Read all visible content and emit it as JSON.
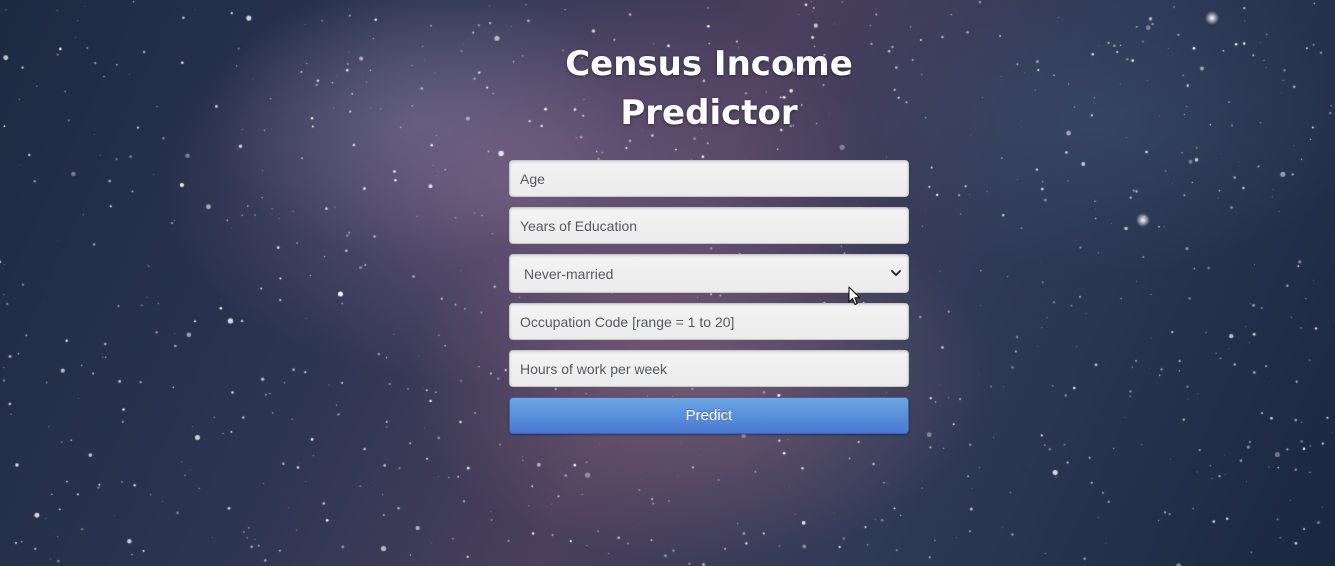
{
  "title": "Census Income Predictor",
  "form": {
    "age_placeholder": "Age",
    "education_placeholder": "Years of Education",
    "marital_status_selected": "Never-married",
    "occupation_placeholder": "Occupation Code [range = 1 to 20]",
    "hours_placeholder": "Hours of work per week",
    "submit_label": "Predict"
  },
  "icons": {
    "select_arrow": "chevron-down-icon",
    "pointer": "mouse-cursor-icon"
  },
  "colors": {
    "button_top": "#6aa7e6",
    "button_bottom": "#4a78d0",
    "title_text": "#ffffff",
    "field_bg": "#efefef"
  }
}
